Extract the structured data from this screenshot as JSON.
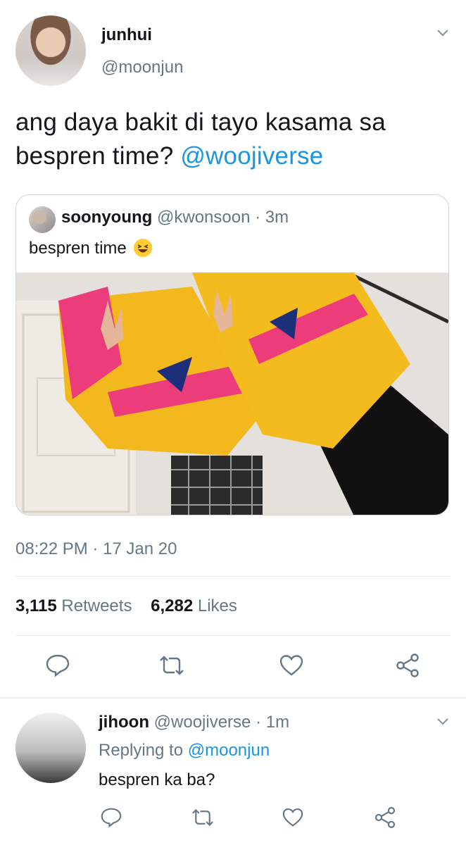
{
  "tweet": {
    "author_name": "junhui",
    "author_handle": "@moonjun",
    "text_prefix": "ang daya bakit di tayo kasama sa bespren time?",
    "text_mention": "@woojiverse",
    "timestamp": "08:22 PM · 17 Jan 20",
    "retweets_count": "3,115",
    "retweets_label": "Retweets",
    "likes_count": "6,282",
    "likes_label": "Likes",
    "icons": [
      "chevron-down-icon",
      "reply-icon",
      "retweet-icon",
      "like-icon",
      "share-icon"
    ]
  },
  "quote": {
    "author_name": "soonyoung",
    "author_handle": "@kwonsoon",
    "time": "· 3m",
    "text": "bespren time",
    "emoji": "laughing-emoji"
  },
  "reply": {
    "author_name": "jihoon",
    "author_handle": "@woojiverse",
    "time": "· 1m",
    "replying_prefix": "Replying to",
    "replying_to": "@moonjun",
    "text": "bespren ka ba?"
  },
  "colors": {
    "link": "#1b95e0",
    "secondary_text": "#657786",
    "border": "#ccd6dd"
  }
}
